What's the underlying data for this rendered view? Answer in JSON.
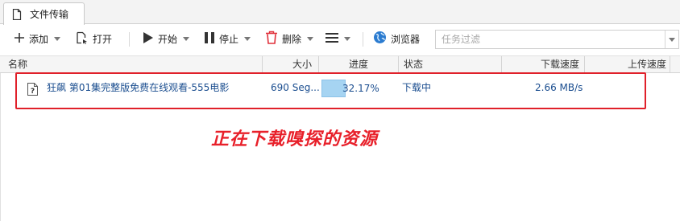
{
  "tab": {
    "label": "文件传输",
    "icon": "file-icon"
  },
  "toolbar": {
    "add_label": "添加",
    "open_label": "打开",
    "start_label": "开始",
    "stop_label": "停止",
    "delete_label": "删除",
    "browser_label": "浏览器"
  },
  "filter": {
    "placeholder": "任务过滤",
    "value": ""
  },
  "columns": {
    "name": "名称",
    "size": "大小",
    "progress": "进度",
    "status": "状态",
    "download_speed": "下载速度",
    "upload_speed": "上传速度"
  },
  "rows": [
    {
      "name": "狂飙 第01集完整版免费在线观看-555电影",
      "size": "690 Seg...",
      "progress_text": "32.17%",
      "progress_fraction": 0.3217,
      "status": "下载中",
      "download_speed": "2.66 MB/s",
      "upload_speed": ""
    }
  ],
  "annotation": "正在下载嗅探的资源",
  "colors": {
    "accent": "#1a4d8f",
    "progress_fill": "#a6d4f2",
    "annotation": "#e8202a",
    "delete_icon": "#e0303a",
    "browser_icon": "#2b7bd0"
  }
}
